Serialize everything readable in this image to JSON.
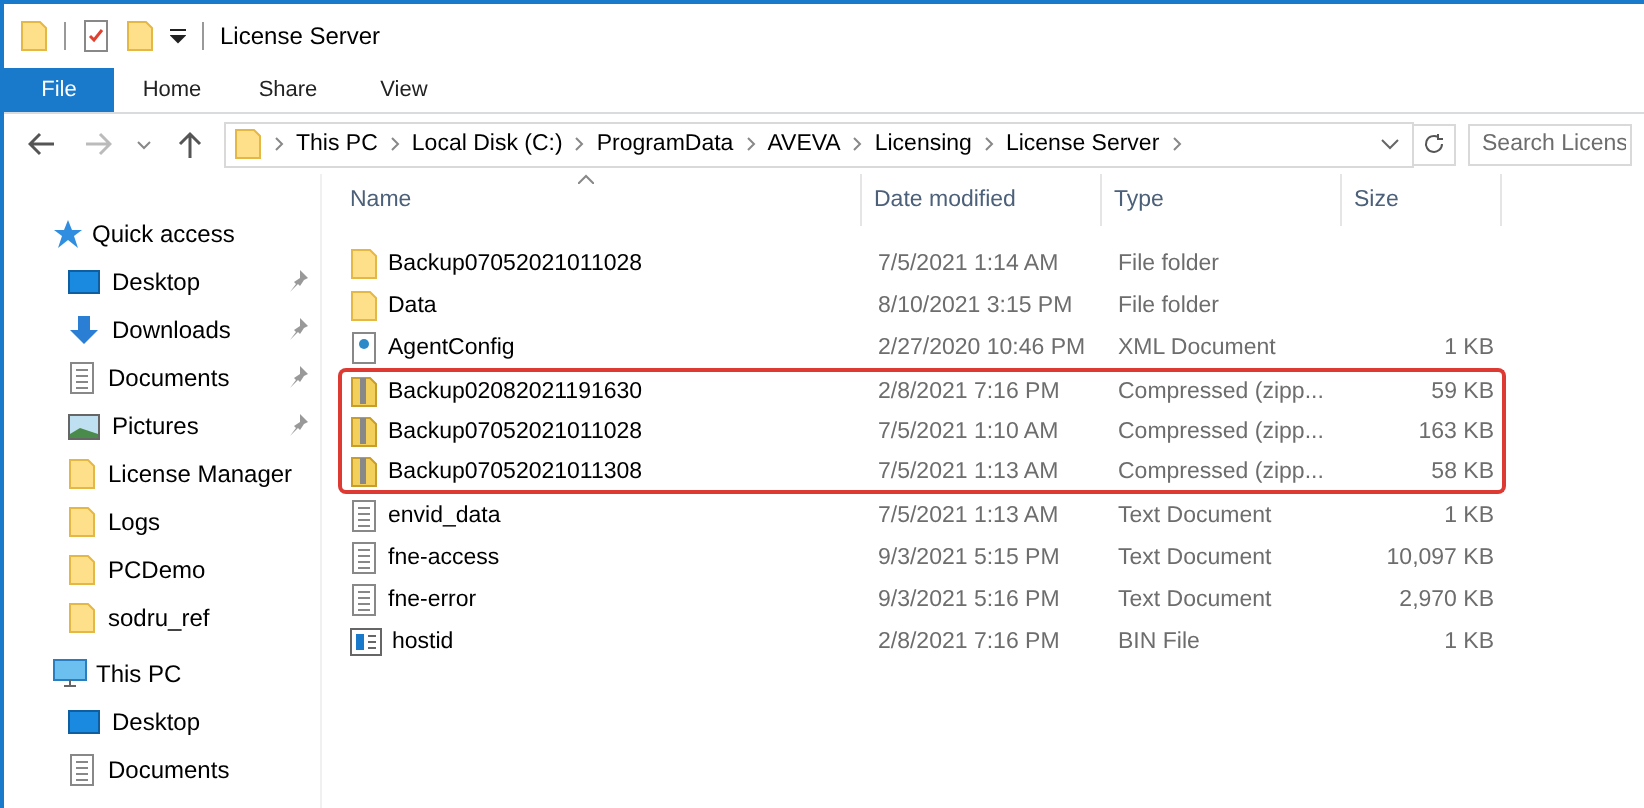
{
  "window": {
    "title": "License Server"
  },
  "ribbon_tabs": [
    {
      "label": "File",
      "selected": true
    },
    {
      "label": "Home",
      "selected": false
    },
    {
      "label": "Share",
      "selected": false
    },
    {
      "label": "View",
      "selected": false
    }
  ],
  "breadcrumb": [
    "This PC",
    "Local Disk (C:)",
    "ProgramData",
    "AVEVA",
    "Licensing",
    "License Server"
  ],
  "search": {
    "placeholder": "Search Licens"
  },
  "sidebar": [
    {
      "label": "Quick access",
      "kind": "star",
      "children": [
        {
          "label": "Desktop",
          "kind": "desktop",
          "pinned": true
        },
        {
          "label": "Downloads",
          "kind": "download",
          "pinned": true
        },
        {
          "label": "Documents",
          "kind": "document",
          "pinned": true
        },
        {
          "label": "Pictures",
          "kind": "picture",
          "pinned": true
        },
        {
          "label": "License Manager",
          "kind": "folder",
          "pinned": false
        },
        {
          "label": "Logs",
          "kind": "folder",
          "pinned": false
        },
        {
          "label": "PCDemo",
          "kind": "folder",
          "pinned": false
        },
        {
          "label": "sodru_ref",
          "kind": "folder",
          "pinned": false
        }
      ]
    },
    {
      "label": "This PC",
      "kind": "pc",
      "children": [
        {
          "label": "Desktop",
          "kind": "desktop",
          "pinned": false
        },
        {
          "label": "Documents",
          "kind": "document",
          "pinned": false
        }
      ]
    }
  ],
  "table": {
    "columns": [
      "Name",
      "Date modified",
      "Type",
      "Size"
    ],
    "rows": [
      {
        "kind": "folder",
        "name": "Backup07052021011028",
        "date": "7/5/2021 1:14 AM",
        "type": "File folder",
        "size": "",
        "highlighted": false
      },
      {
        "kind": "folder",
        "name": "Data",
        "date": "8/10/2021 3:15 PM",
        "type": "File folder",
        "size": "",
        "highlighted": false
      },
      {
        "kind": "xml",
        "name": "AgentConfig",
        "date": "2/27/2020 10:46 PM",
        "type": "XML Document",
        "size": "1 KB",
        "highlighted": false
      },
      {
        "kind": "zip",
        "name": "Backup02082021191630",
        "date": "2/8/2021 7:16 PM",
        "type": "Compressed (zipp...",
        "size": "59 KB",
        "highlighted": true
      },
      {
        "kind": "zip",
        "name": "Backup07052021011028",
        "date": "7/5/2021 1:10 AM",
        "type": "Compressed (zipp...",
        "size": "163 KB",
        "highlighted": true
      },
      {
        "kind": "zip",
        "name": "Backup07052021011308",
        "date": "7/5/2021 1:13 AM",
        "type": "Compressed (zipp...",
        "size": "58 KB",
        "highlighted": true
      },
      {
        "kind": "text",
        "name": "envid_data",
        "date": "7/5/2021 1:13 AM",
        "type": "Text Document",
        "size": "1 KB",
        "highlighted": false
      },
      {
        "kind": "text",
        "name": "fne-access",
        "date": "9/3/2021 5:15 PM",
        "type": "Text Document",
        "size": "10,097 KB",
        "highlighted": false
      },
      {
        "kind": "text",
        "name": "fne-error",
        "date": "9/3/2021 5:16 PM",
        "type": "Text Document",
        "size": "2,970 KB",
        "highlighted": false
      },
      {
        "kind": "bin",
        "name": "hostid",
        "date": "2/8/2021 7:16 PM",
        "type": "BIN File",
        "size": "1 KB",
        "highlighted": false
      }
    ]
  }
}
